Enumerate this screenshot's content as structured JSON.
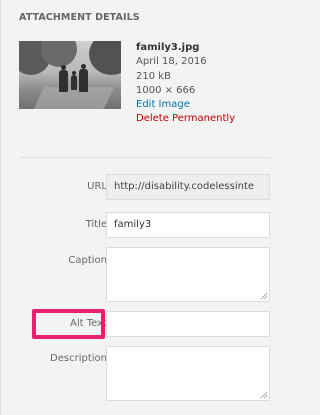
{
  "section": {
    "heading": "ATTACHMENT DETAILS"
  },
  "file": {
    "name": "family3.jpg",
    "date": "April 18, 2016",
    "size": "210 kB",
    "dimensions": "1000 × 666",
    "edit_link": "Edit Image",
    "delete_link": "Delete Permanently"
  },
  "fields": {
    "url": {
      "label": "URL",
      "value": "http://disability.codelessinte"
    },
    "title": {
      "label": "Title",
      "value": "family3"
    },
    "caption": {
      "label": "Caption",
      "value": ""
    },
    "alt": {
      "label": "Alt Text",
      "value": ""
    },
    "description": {
      "label": "Description",
      "value": ""
    }
  },
  "colors": {
    "link": "#0073aa",
    "danger": "#bc0000",
    "highlight": "#e7226c"
  }
}
